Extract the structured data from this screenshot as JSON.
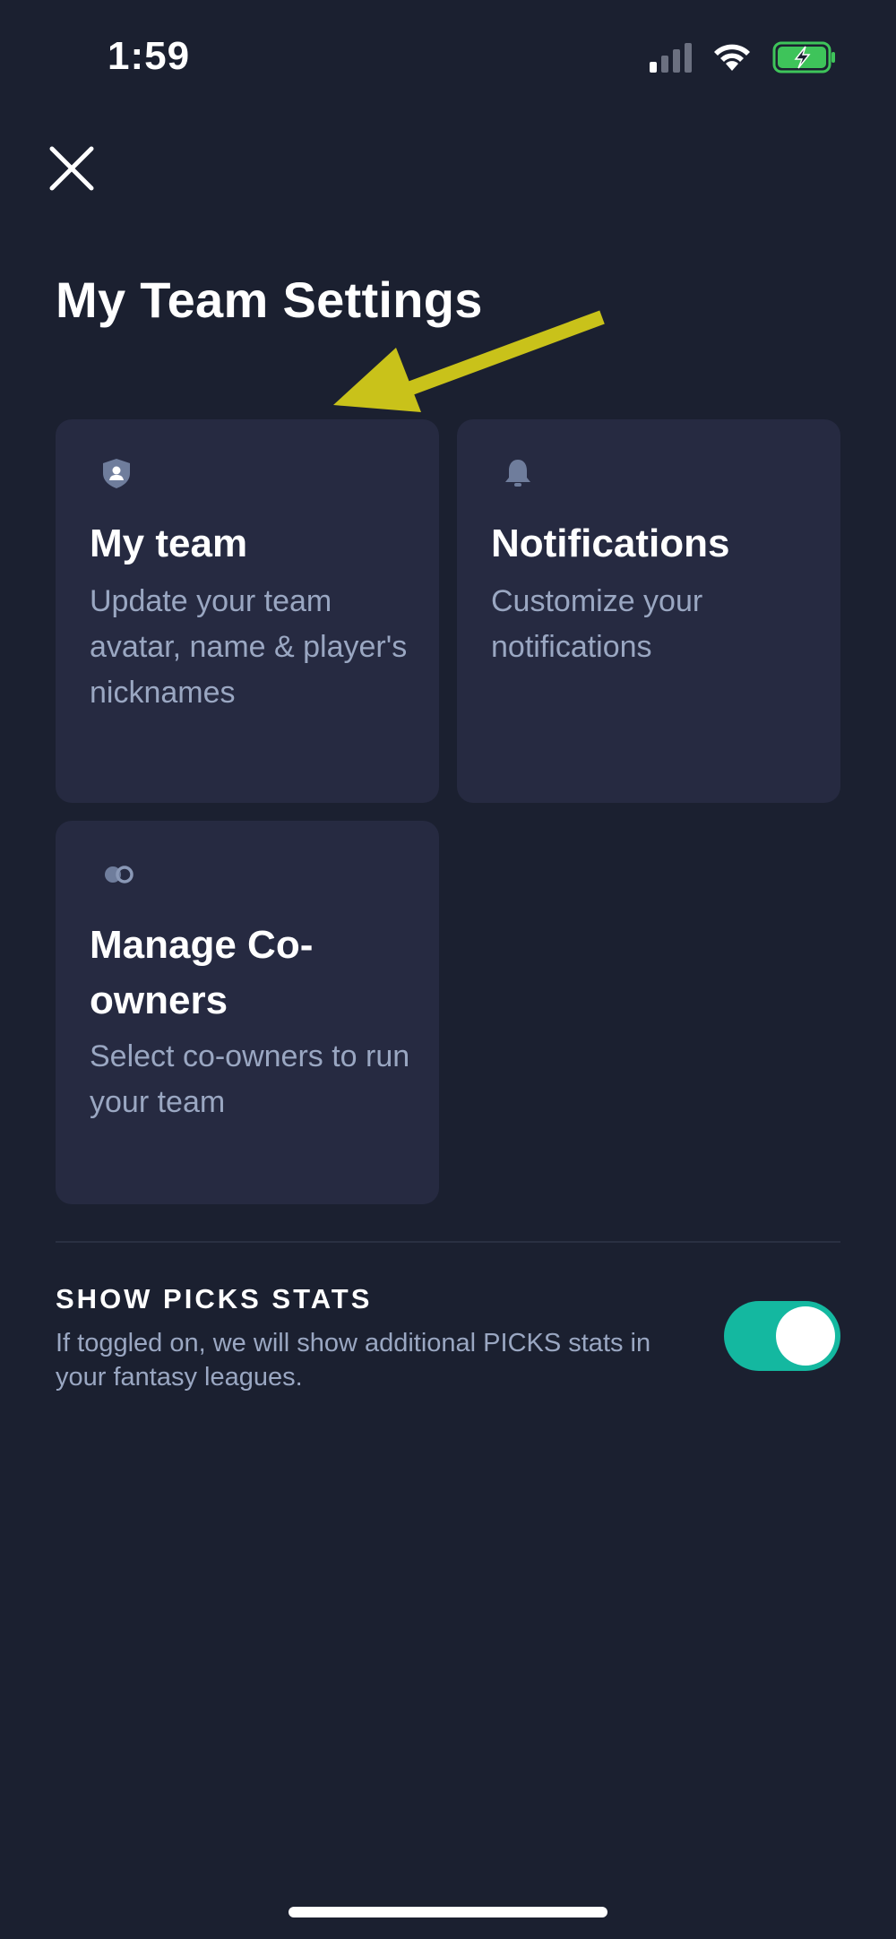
{
  "status_bar": {
    "time": "1:59",
    "icons": [
      "signal-icon",
      "wifi-icon",
      "battery-charging-icon"
    ]
  },
  "header": {
    "close_icon": "close-icon",
    "title": "My Team Settings"
  },
  "cards": [
    {
      "icon": "shield-user-icon",
      "title": "My team",
      "description": "Update your team avatar, name & player's nicknames"
    },
    {
      "icon": "bell-icon",
      "title": "Notifications",
      "description": "Customize your notifications"
    },
    {
      "icon": "co-owners-icon",
      "title": "Manage Co-owners",
      "description": "Select co-owners to run your team"
    }
  ],
  "picks_stats": {
    "label": "SHOW PICKS STATS",
    "description": "If toggled on, we will show additional PICKS stats in your fantasy leagues.",
    "enabled": true
  },
  "colors": {
    "background": "#1b2030",
    "card": "#262a41",
    "toggle_on": "#14b8a0",
    "annotation_arrow": "#c9c21a",
    "battery": "#3ec45a"
  }
}
